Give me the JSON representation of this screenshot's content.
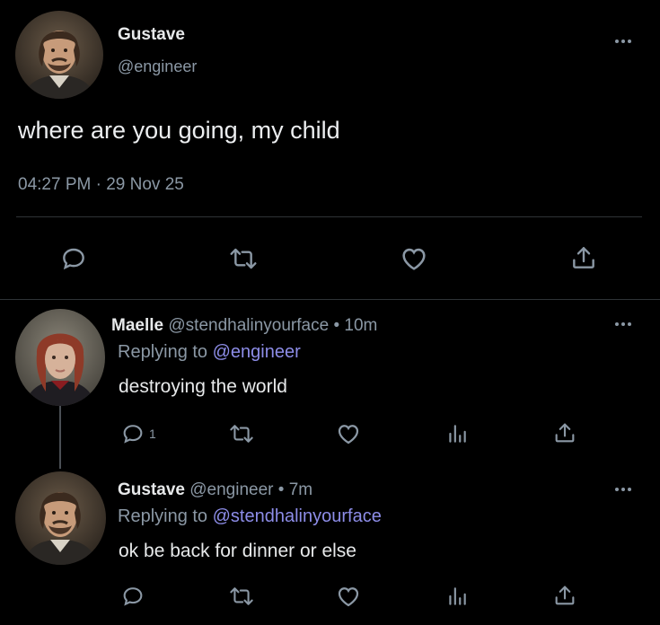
{
  "main_tweet": {
    "author_name": "Gustave",
    "author_handle": "@engineer",
    "text": "where are you going, my child",
    "time": "04:27 PM",
    "separator": "·",
    "date": "29 Nov 25"
  },
  "replies": [
    {
      "author_name": "Maelle",
      "author_handle": "@stendhalinyourface",
      "dot": "•",
      "time_ago": "10m",
      "replying_prefix": "Replying to",
      "replying_to": "@engineer",
      "text": "destroying the world",
      "reply_count": "1"
    },
    {
      "author_name": "Gustave",
      "author_handle": "@engineer",
      "dot": "•",
      "time_ago": "7m",
      "replying_prefix": "Replying to",
      "replying_to": "@stendhalinyourface",
      "text": "ok be back for dinner or else",
      "reply_count": ""
    }
  ],
  "icons": {
    "reply": "speech-bubble-icon",
    "retweet": "retweet-icon",
    "like": "heart-icon",
    "analytics": "bar-chart-icon",
    "share": "share-icon",
    "more": "more-dots-icon"
  },
  "colors": {
    "background": "#000000",
    "text": "#e7e9ea",
    "muted": "#8b98a5",
    "link": "#8d8de8",
    "divider": "#2f3336"
  }
}
